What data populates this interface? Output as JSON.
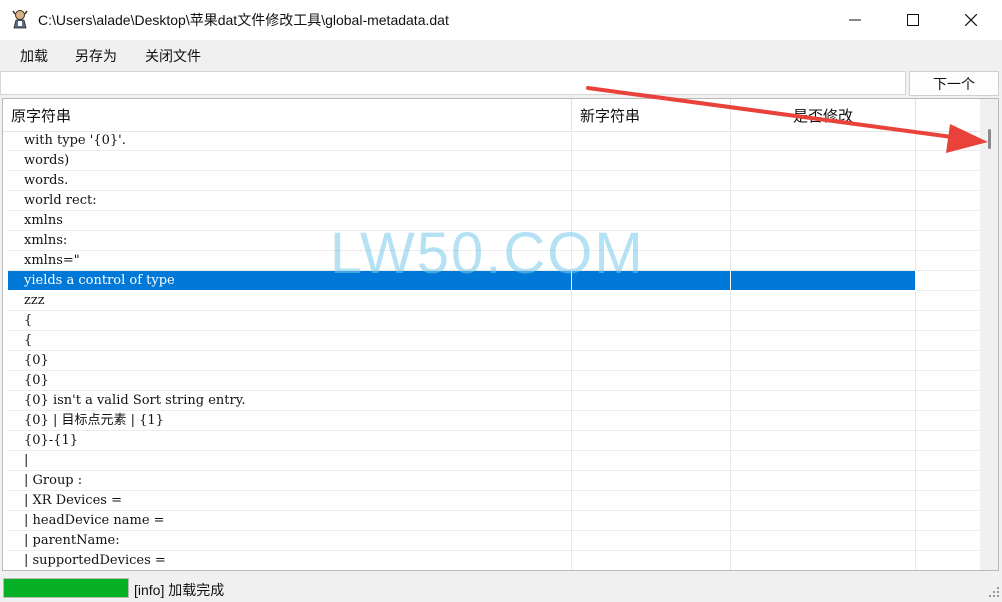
{
  "window": {
    "title": "C:\\Users\\alade\\Desktop\\苹果dat文件修改工具\\global-metadata.dat",
    "icon": "app-character-icon"
  },
  "menu": {
    "items": [
      "加载",
      "另存为",
      "关闭文件"
    ]
  },
  "search": {
    "value": "",
    "next_label": "下一个"
  },
  "grid": {
    "columns": [
      "原字符串",
      "新字符串",
      "是否修改",
      ""
    ],
    "selected_index": 7,
    "rows": [
      [
        "with type '{0}'.",
        "",
        "",
        ""
      ],
      [
        "words)",
        "",
        "",
        ""
      ],
      [
        "words.",
        "",
        "",
        ""
      ],
      [
        "world rect:",
        "",
        "",
        ""
      ],
      [
        "xmlns",
        "",
        "",
        ""
      ],
      [
        "xmlns:",
        "",
        "",
        ""
      ],
      [
        "xmlns=\"",
        "",
        "",
        ""
      ],
      [
        "yields a control of type",
        "",
        "",
        ""
      ],
      [
        "zzz",
        "",
        "",
        ""
      ],
      [
        "{",
        "",
        "",
        ""
      ],
      [
        "{",
        "",
        "",
        ""
      ],
      [
        "{0}",
        "",
        "",
        ""
      ],
      [
        "{0}",
        "",
        "",
        ""
      ],
      [
        "{0} isn't a valid Sort string entry.",
        "",
        "",
        ""
      ],
      [
        "{0} | 目标点元素 | {1}",
        "",
        "",
        ""
      ],
      [
        "{0}-{1}",
        "",
        "",
        ""
      ],
      [
        "|",
        "",
        "",
        ""
      ],
      [
        "| Group :",
        "",
        "",
        ""
      ],
      [
        "| XR Devices =",
        "",
        "",
        ""
      ],
      [
        "| headDevice name =",
        "",
        "",
        ""
      ],
      [
        "| parentName:",
        "",
        "",
        ""
      ],
      [
        "| supportedDevices =",
        "",
        "",
        ""
      ]
    ]
  },
  "watermark": "LW50.COM",
  "status": {
    "text": "[info] 加载完成",
    "progress": 1.0
  },
  "colors": {
    "selection": "#0078d7",
    "progress": "#06b025",
    "annotation_arrow": "#e8423a",
    "watermark": "#78c8eb"
  }
}
